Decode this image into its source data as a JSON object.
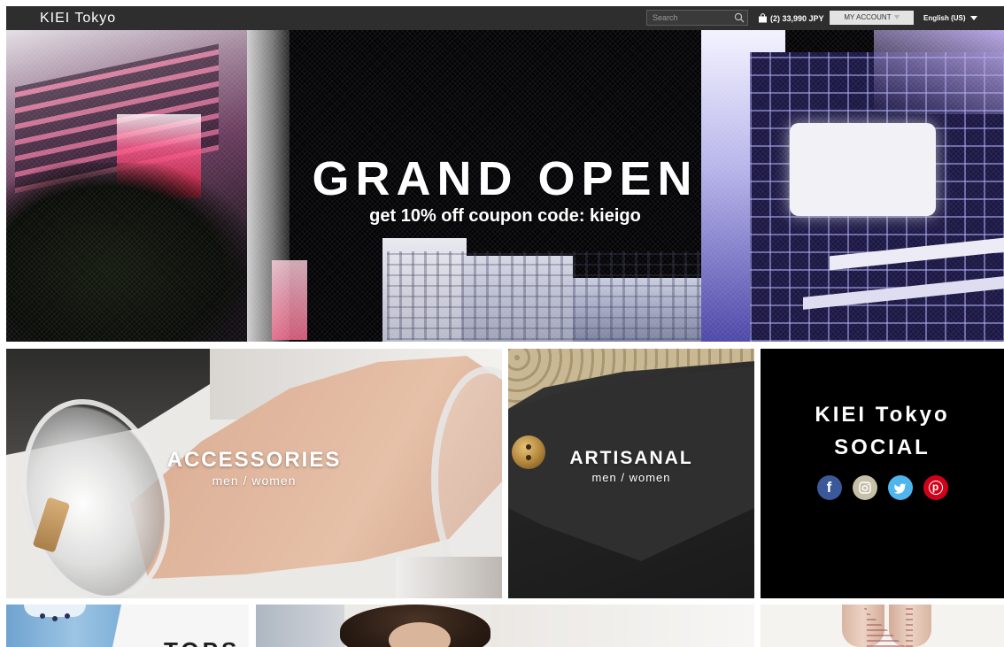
{
  "header": {
    "logo": "KIEI Tokyo",
    "search": {
      "placeholder": "Search",
      "value": ""
    },
    "cart_summary": "(2) 33,990 JPY",
    "account_label": "MY ACCOUNT",
    "language": "English (US)"
  },
  "hero": {
    "title": "GRAND OPEN",
    "subtitle": "get 10% off coupon code: kieigo"
  },
  "categories": [
    {
      "title": "ACCESSORIES",
      "subtitle": "men / women"
    },
    {
      "title": "ARTISANAL",
      "subtitle": "men / women"
    }
  ],
  "social": {
    "title_line1": "KIEI Tokyo",
    "title_line2": "SOCIAL",
    "icons": [
      {
        "name": "facebook-icon",
        "glyph": "f",
        "color": "#3b5998"
      },
      {
        "name": "instagram-icon",
        "color": "#c6c0a8"
      },
      {
        "name": "twitter-icon",
        "color": "#4fb5ec"
      },
      {
        "name": "pinterest-icon",
        "glyph": "p",
        "color": "#d0021b"
      }
    ]
  },
  "bottom_tiles": [
    {
      "title": "TOPS"
    }
  ]
}
